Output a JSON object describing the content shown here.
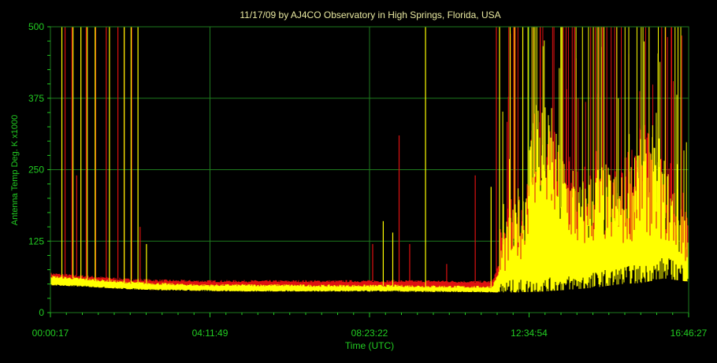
{
  "chart_data": {
    "type": "line",
    "title": "11/17/09  by  AJ4CO Observatory  in  High Springs, Florida, USA",
    "xlabel": "Time (UTC)",
    "ylabel": "Antenna Temp Deg. K x1000",
    "ylim": [
      0,
      500
    ],
    "y_ticks": [
      "0",
      "125",
      "250",
      "375",
      "500"
    ],
    "x_range_seconds": [
      17,
      60387
    ],
    "x_ticks": [
      "00:00:17",
      "04:11:49",
      "08:23:22",
      "12:34:54",
      "16:46:27"
    ],
    "grid": true,
    "colors": {
      "background": "#000000",
      "axes_text": "#22cc22",
      "grid": "#1e7a1e",
      "series_red": "#dd1111",
      "series_yellow": "#ffff00",
      "title": "#e8e8a0"
    },
    "series": [
      {
        "color": "#dd1111",
        "baseline_x_seconds": [
          17,
          3600,
          7200,
          10800,
          14400,
          18000,
          21600,
          25200,
          28800,
          32400,
          36000,
          39600,
          41800,
          43200,
          44600,
          46000,
          48000,
          50000,
          52000,
          54000,
          56000,
          58000,
          60387
        ],
        "baseline_values": [
          68,
          63,
          58,
          56,
          55,
          55,
          55,
          55,
          55,
          55,
          55,
          54,
          54,
          120,
          140,
          230,
          190,
          150,
          175,
          160,
          210,
          180,
          120
        ],
        "spikes_x_seconds": [
          1400,
          2050,
          2500,
          3400,
          4300,
          5300,
          6400,
          6990,
          7700,
          8500,
          30500,
          33000,
          34000,
          37500,
          40200,
          42200
        ],
        "spikes_values": [
          500,
          500,
          240,
          500,
          500,
          500,
          500,
          500,
          500,
          150,
          120,
          310,
          120,
          85,
          240,
          500
        ]
      },
      {
        "color": "#ffff00",
        "baseline_x_seconds": [
          17,
          3600,
          7200,
          10800,
          14400,
          18000,
          21600,
          25200,
          28800,
          32400,
          36000,
          39600,
          41800,
          43200,
          44600,
          46000,
          48000,
          50000,
          52000,
          54000,
          56000,
          58000,
          60387
        ],
        "baseline_values": [
          63,
          58,
          53,
          50,
          48,
          48,
          48,
          47,
          47,
          47,
          46,
          45,
          45,
          100,
          130,
          250,
          190,
          140,
          165,
          150,
          190,
          170,
          105
        ],
        "spikes_x_seconds": [
          1100,
          2150,
          2900,
          3500,
          4250,
          5600,
          7000,
          7650,
          8300,
          9100,
          31500,
          32400,
          35500,
          41700,
          42500,
          43500,
          44700,
          45200
        ],
        "spikes_values": [
          500,
          500,
          500,
          500,
          500,
          500,
          500,
          500,
          500,
          120,
          160,
          140,
          500,
          220,
          500,
          500,
          500,
          500
        ]
      },
      {
        "color": "#000000",
        "baseline_x_seconds": [
          17,
          3600,
          7200,
          10800,
          14400,
          18000,
          21600,
          25200,
          28800,
          32400,
          36000,
          39600,
          43200,
          46800,
          50400,
          52000,
          54000,
          56000,
          58000,
          60387
        ],
        "baseline_values": [
          48,
          45,
          41,
          39,
          38,
          37,
          37,
          37,
          37,
          37,
          36,
          36,
          35,
          37,
          42,
          45,
          50,
          52,
          60,
          54
        ]
      }
    ]
  }
}
